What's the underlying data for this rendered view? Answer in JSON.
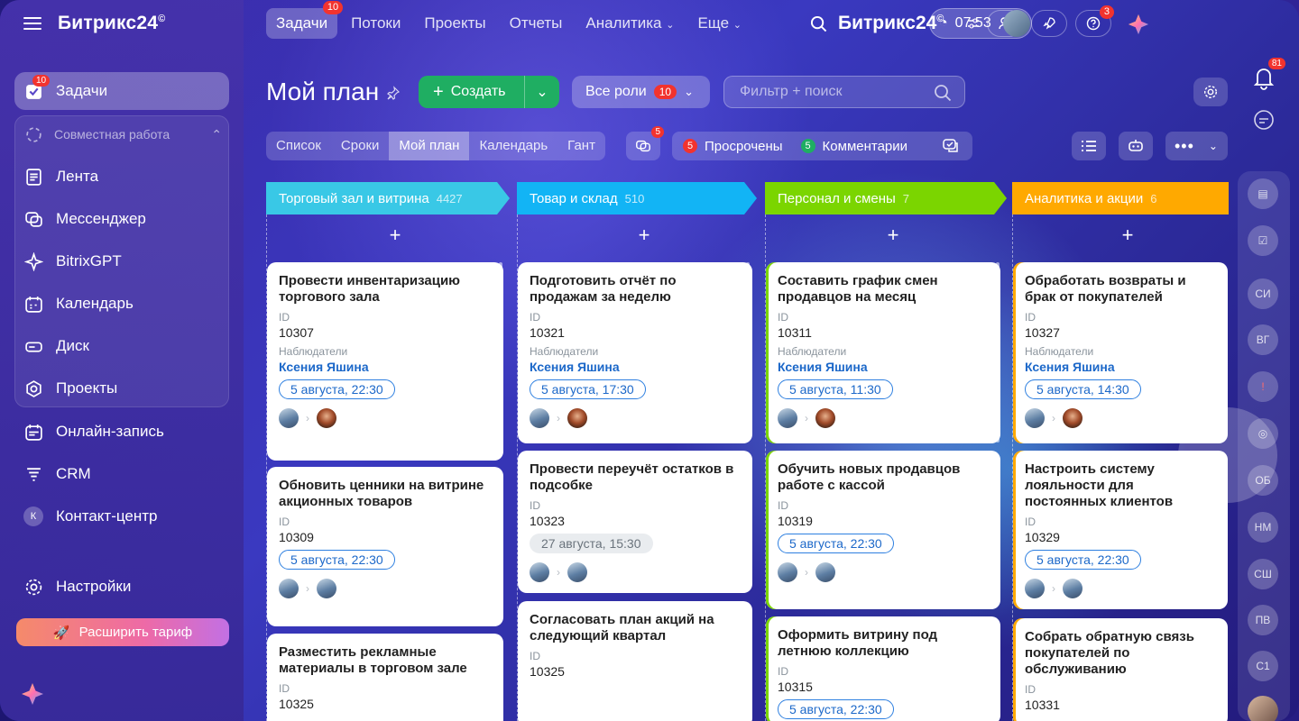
{
  "brand": {
    "name": "Битрикс24",
    "mark": "©"
  },
  "sidebar": {
    "items": [
      {
        "label": "Задачи",
        "badge": "10"
      },
      {
        "label": "Совместная работа"
      },
      {
        "label": "Лента"
      },
      {
        "label": "Мессенджер"
      },
      {
        "label": "BitrixGPT"
      },
      {
        "label": "Календарь"
      },
      {
        "label": "Диск"
      },
      {
        "label": "Проекты"
      },
      {
        "label": "Онлайн-запись"
      },
      {
        "label": "CRM"
      },
      {
        "label": "Контакт-центр",
        "initial": "К"
      },
      {
        "label": "Настройки"
      }
    ],
    "upgrade_label": "Расширить тариф"
  },
  "topnav": {
    "tabs": [
      {
        "label": "Задачи",
        "badge": "10"
      },
      {
        "label": "Потоки"
      },
      {
        "label": "Проекты"
      },
      {
        "label": "Отчеты"
      },
      {
        "label": "Аналитика"
      },
      {
        "label": "Еще"
      }
    ],
    "help_badge": "3",
    "time": "07:53"
  },
  "header": {
    "title": "Мой план",
    "create_label": "Создать",
    "roles_label": "Все роли",
    "roles_badge": "10",
    "filter_placeholder": "Фильтр + поиск"
  },
  "views": [
    "Список",
    "Сроки",
    "Мой план",
    "Календарь",
    "Гант"
  ],
  "chat_badge": "5",
  "counters": {
    "overdue_count": "5",
    "overdue_label": "Просрочены",
    "comments_count": "5",
    "comments_label": "Комментарии"
  },
  "labels": {
    "id": "ID",
    "observers": "Наблюдатели",
    "add": "+"
  },
  "columns": [
    {
      "title": "Торговый зал и витрина",
      "count": "4427",
      "color": "#39c8e6",
      "cards": [
        {
          "title": "Провести инвентаризацию торгового зала",
          "id": "10307",
          "observer": "Ксения Яшина",
          "date": "5 августа, 22:30"
        },
        {
          "title": "Обновить ценники на витрине акционных товаров",
          "id": "10309",
          "date": "5 августа, 22:30"
        },
        {
          "title": "Разместить рекламные материалы в торговом зале",
          "id": "10325"
        }
      ]
    },
    {
      "title": "Товар и склад",
      "count": "510",
      "color": "#12b4f5",
      "cards": [
        {
          "title": "Подготовить отчёт по продажам за неделю",
          "id": "10321",
          "observer": "Ксения Яшина",
          "date": "5 августа, 17:30"
        },
        {
          "title": "Провести переучёт остатков в подсобке",
          "id": "10323",
          "date": "27 августа, 15:30"
        },
        {
          "title": "Согласовать план акций на следующий квартал",
          "id": "10325"
        }
      ]
    },
    {
      "title": "Персонал и смены",
      "count": "7",
      "color": "#7bd500",
      "cards": [
        {
          "title": "Составить график смен продавцов на месяц",
          "id": "10311",
          "observer": "Ксения Яшина",
          "date": "5 августа, 11:30"
        },
        {
          "title": "Обучить новых продавцов работе с кассой",
          "id": "10319",
          "date": "5 августа, 22:30"
        },
        {
          "title": "Оформить витрину под летнюю коллекцию",
          "id": "10315",
          "date": "5 августа, 22:30"
        }
      ]
    },
    {
      "title": "Аналитика и акции",
      "count": "6",
      "color": "#ffa900",
      "cards": [
        {
          "title": "Обработать возвраты и брак от покупателей",
          "id": "10327",
          "observer": "Ксения Яшина",
          "date": "5 августа, 14:30"
        },
        {
          "title": "Настроить систему лояльности для постоянных клиентов",
          "id": "10329",
          "date": "5 августа, 22:30"
        },
        {
          "title": "Собрать обратную связь покупателей по обслуживанию",
          "id": "10331"
        }
      ]
    }
  ],
  "right_rail": {
    "notifications_badge": "81",
    "avatars": [
      "СИ",
      "ВГ",
      "ОБ",
      "НМ",
      "СШ",
      "ПВ",
      "С1"
    ]
  }
}
